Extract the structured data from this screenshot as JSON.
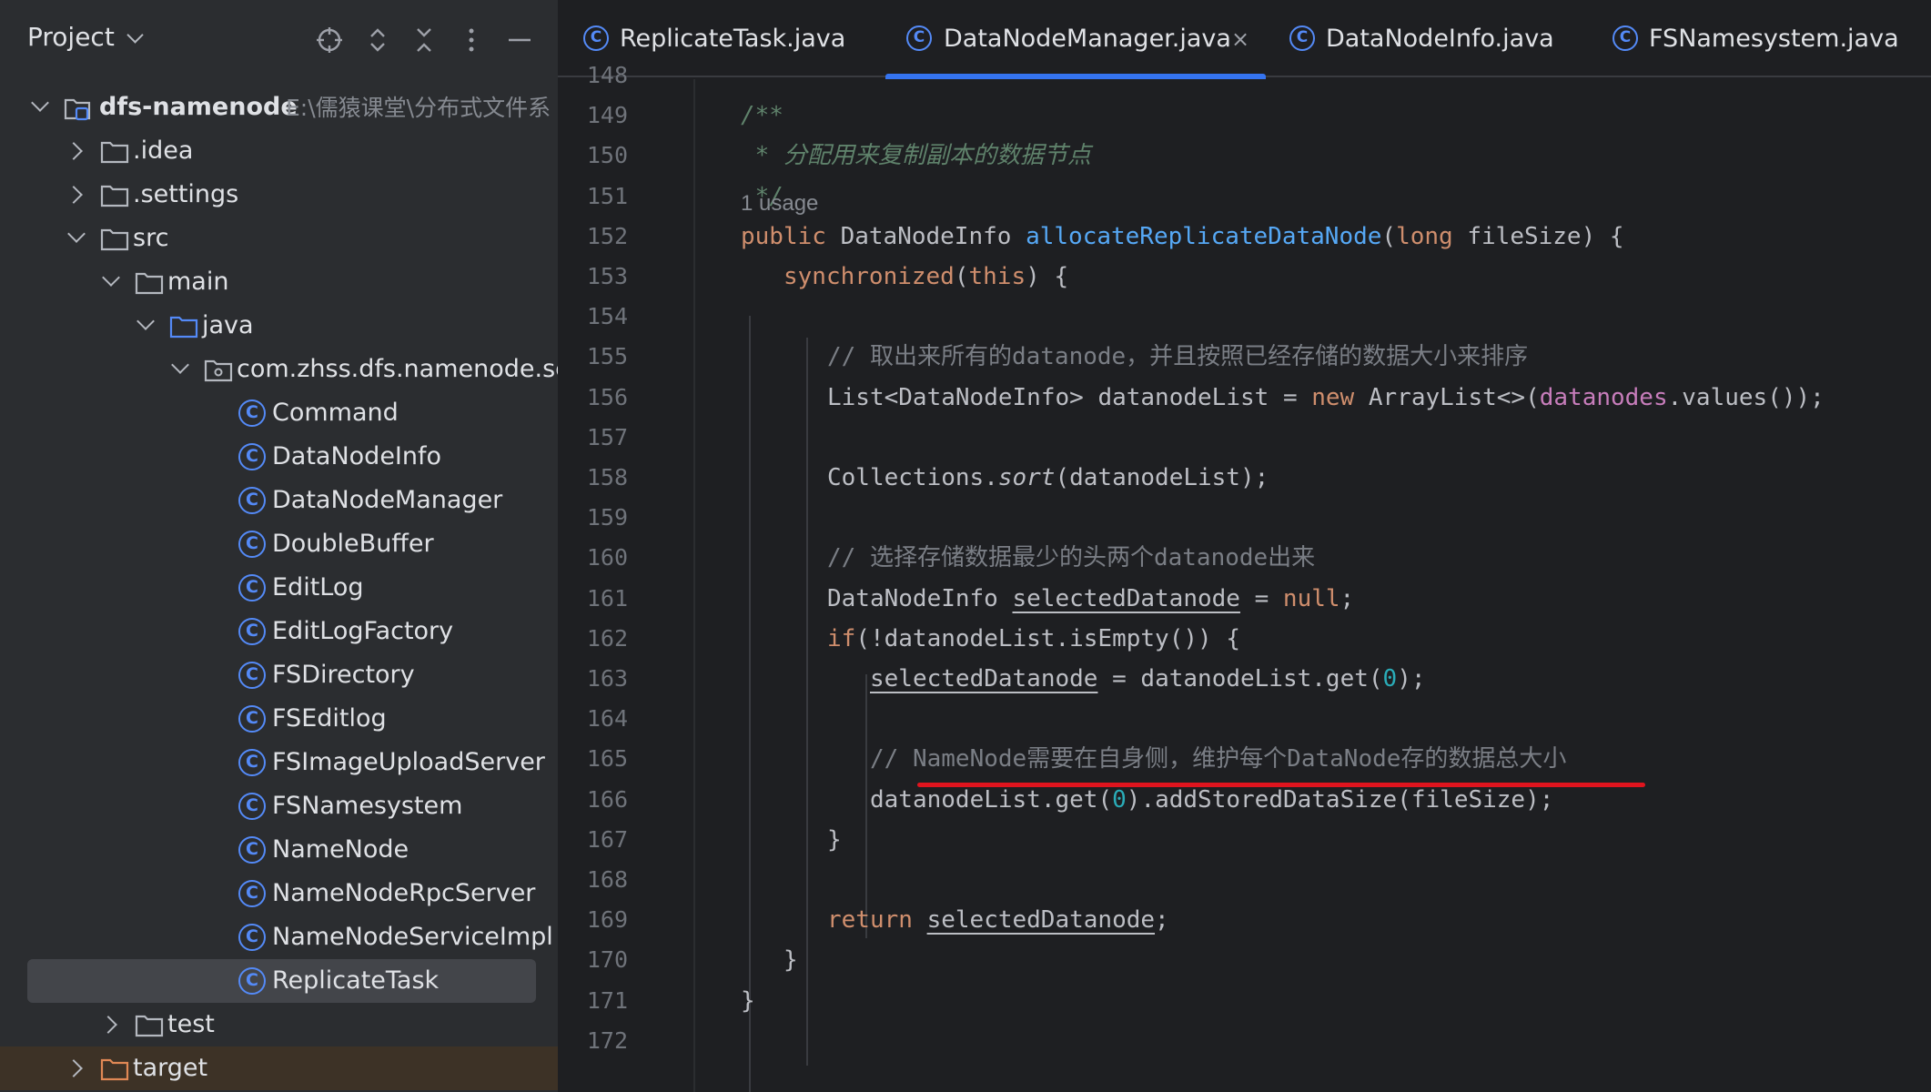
{
  "project_panel": {
    "title": "Project",
    "header_icons": [
      "crosshair-icon",
      "expand-collapse-icon",
      "collapse-all-icon",
      "more-options-icon",
      "minimize-icon"
    ],
    "tree": [
      {
        "label": "dfs-namenode",
        "path": "E:\\儒猿课堂\\分布式文件系",
        "type": "module"
      },
      {
        "label": ".idea",
        "type": "folder"
      },
      {
        "label": ".settings",
        "type": "folder"
      },
      {
        "label": "src",
        "type": "folder"
      },
      {
        "label": "main",
        "type": "folder"
      },
      {
        "label": "java",
        "type": "source-folder"
      },
      {
        "label": "com.zhss.dfs.namenode.serv",
        "type": "package"
      },
      {
        "label": "Command",
        "type": "class"
      },
      {
        "label": "DataNodeInfo",
        "type": "class"
      },
      {
        "label": "DataNodeManager",
        "type": "class"
      },
      {
        "label": "DoubleBuffer",
        "type": "class"
      },
      {
        "label": "EditLog",
        "type": "class"
      },
      {
        "label": "EditLogFactory",
        "type": "class"
      },
      {
        "label": "FSDirectory",
        "type": "class"
      },
      {
        "label": "FSEditlog",
        "type": "class"
      },
      {
        "label": "FSImageUploadServer",
        "type": "class"
      },
      {
        "label": "FSNamesystem",
        "type": "class"
      },
      {
        "label": "NameNode",
        "type": "class"
      },
      {
        "label": "NameNodeRpcServer",
        "type": "class"
      },
      {
        "label": "NameNodeServiceImpl",
        "type": "class"
      },
      {
        "label": "ReplicateTask",
        "type": "class",
        "selected": true
      },
      {
        "label": "test",
        "type": "folder"
      },
      {
        "label": "target",
        "type": "excluded-folder"
      }
    ]
  },
  "editor": {
    "tabs": [
      {
        "label": "ReplicateTask.java",
        "active": false
      },
      {
        "label": "DataNodeManager.java",
        "active": true,
        "close": "×"
      },
      {
        "label": "DataNodeInfo.java",
        "active": false
      },
      {
        "label": "FSNamesystem.java",
        "active": false
      }
    ],
    "usage_hint": "1 usage",
    "lines": [
      {
        "n": "148",
        "code": ""
      },
      {
        "n": "149",
        "code": "/**"
      },
      {
        "n": "150",
        "code": " * 分配用来复制副本的数据节点"
      },
      {
        "n": "151",
        "code": " */"
      },
      {
        "n": "152",
        "code": "public DataNodeInfo allocateReplicateDataNode(long fileSize) {"
      },
      {
        "n": "153",
        "code": "synchronized(this) {"
      },
      {
        "n": "154",
        "code": ""
      },
      {
        "n": "155",
        "code": "// 取出来所有的datanode，并且按照已经存储的数据大小来排序"
      },
      {
        "n": "156",
        "code": "List<DataNodeInfo> datanodeList = new ArrayList<>(datanodes.values());"
      },
      {
        "n": "157",
        "code": ""
      },
      {
        "n": "158",
        "code": "Collections.sort(datanodeList);"
      },
      {
        "n": "159",
        "code": ""
      },
      {
        "n": "160",
        "code": "// 选择存储数据最少的头两个datanode出来"
      },
      {
        "n": "161",
        "code": "DataNodeInfo selectedDatanode = null;"
      },
      {
        "n": "162",
        "code": "if(!datanodeList.isEmpty()) {"
      },
      {
        "n": "163",
        "code": "selectedDatanode = datanodeList.get(0);"
      },
      {
        "n": "164",
        "code": ""
      },
      {
        "n": "165",
        "code": "// NameNode需要在自身侧，维护每个DataNode存的数据总大小"
      },
      {
        "n": "166",
        "code": "datanodeList.get(0).addStoredDataSize(fileSize);"
      },
      {
        "n": "167",
        "code": "}"
      },
      {
        "n": "168",
        "code": ""
      },
      {
        "n": "169",
        "code": "return selectedDatanode;"
      },
      {
        "n": "170",
        "code": "}"
      },
      {
        "n": "171",
        "code": "}"
      },
      {
        "n": "172",
        "code": ""
      }
    ]
  },
  "colors": {
    "accent": "#3574f0",
    "annotation_underline": "#e0141e",
    "keyword": "#cf8e6d",
    "method": "#56a8f5",
    "field": "#c77dbb",
    "number": "#2aacb8",
    "comment": "#7a7e85",
    "doc_comment": "#5f826b"
  }
}
